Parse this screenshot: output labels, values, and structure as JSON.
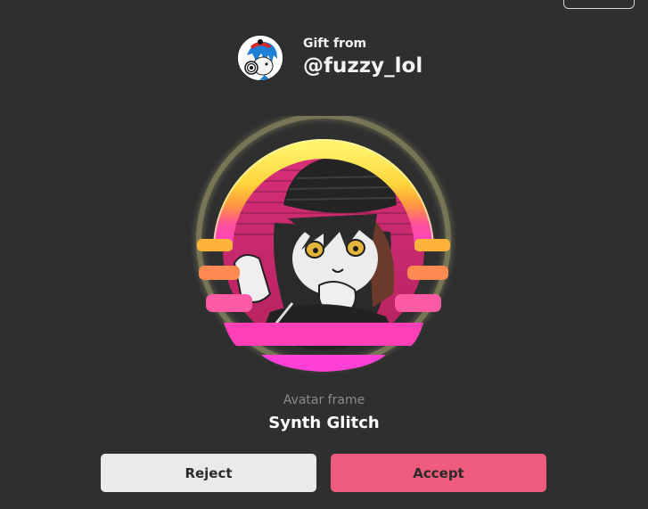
{
  "sender": {
    "caption": "Gift from",
    "username": "@fuzzy_lol",
    "avatar_icon": "blue-haired-character-avatar"
  },
  "item": {
    "type_label": "Avatar frame",
    "name": "Synth Glitch",
    "frame_icon": "synthwave-sun-frame-with-character"
  },
  "actions": {
    "reject_label": "Reject",
    "accept_label": "Accept"
  },
  "colors": {
    "background": "#2e2f2f",
    "accept": "#ee5b7c",
    "reject": "#e9ebea",
    "frame_yellow": "#ffe34d",
    "frame_orange": "#ff9a3d",
    "frame_pink": "#ff3fa0",
    "frame_magenta": "#ff3fc8"
  }
}
